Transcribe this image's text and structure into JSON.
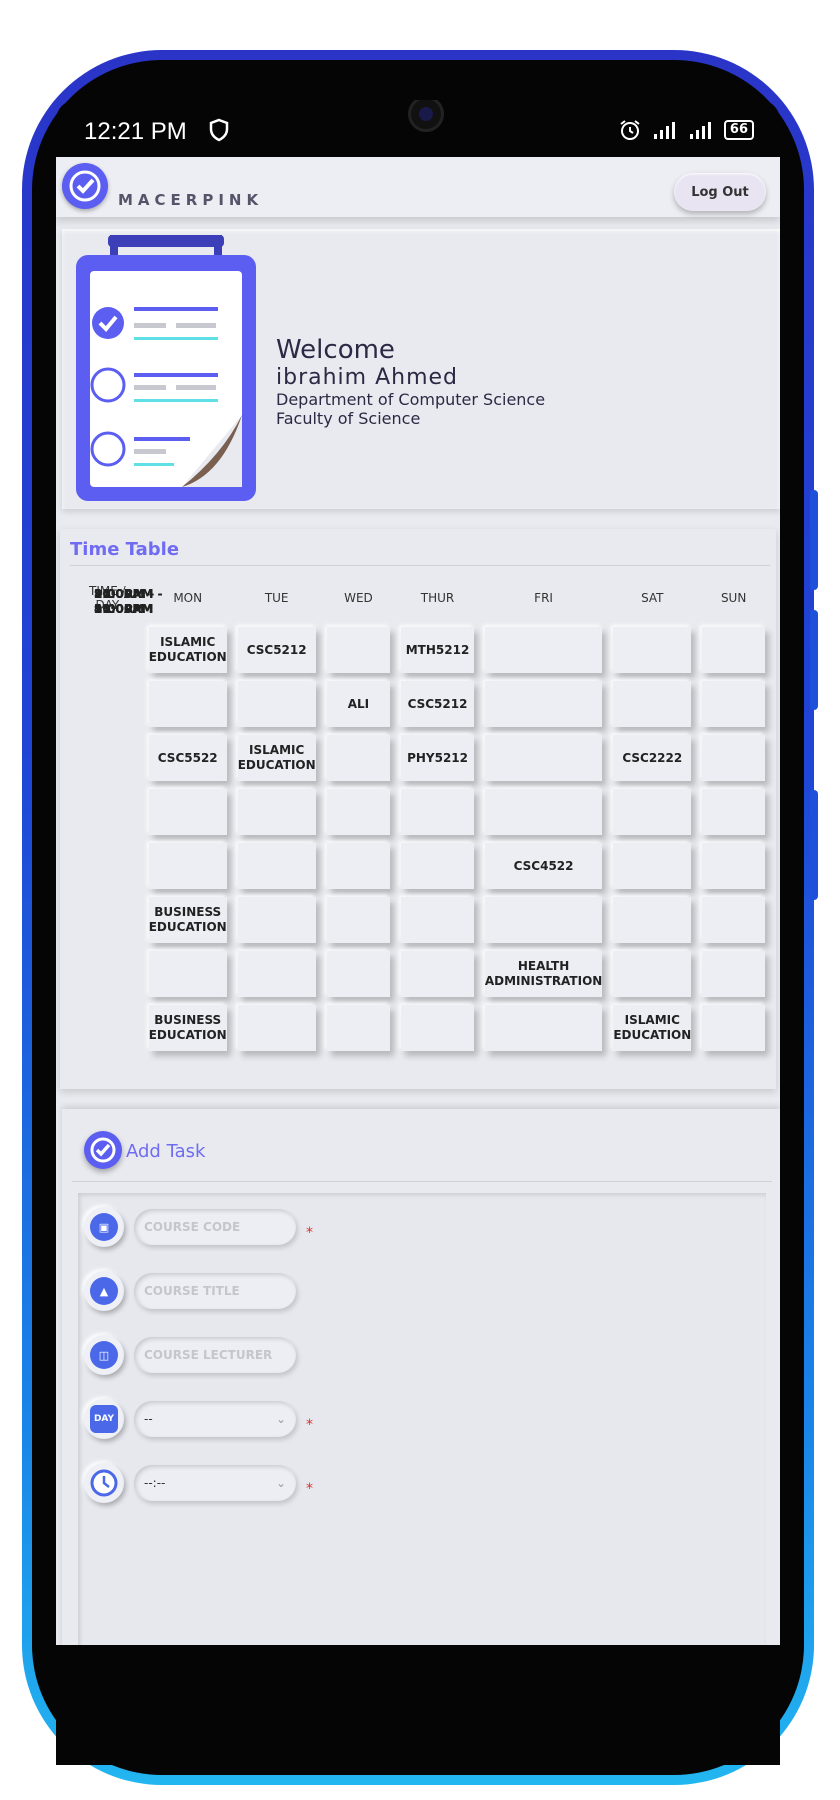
{
  "statusbar": {
    "time": "12:21 PM",
    "battery": "66"
  },
  "header": {
    "brand": "MACERPINK",
    "logout_label": "Log Out"
  },
  "welcome": {
    "greeting": "Welcome",
    "name": "ibrahim Ahmed",
    "department": "Department of Computer Science",
    "faculty": "Faculty of Science"
  },
  "timetable": {
    "title": "Time Table",
    "time_header": "TIME / DAY",
    "days": [
      "MON",
      "TUE",
      "WED",
      "THUR",
      "FRI",
      "SAT",
      "SUN"
    ],
    "rows": [
      {
        "time": "8:00AM - 9:00AM",
        "cells": [
          "ISLAMIC EDUCATION",
          "CSC5212",
          "",
          "MTH5212",
          "",
          "",
          ""
        ]
      },
      {
        "time": "9:00AM - 10:00AM",
        "cells": [
          "",
          "",
          "ALI",
          "CSC5212",
          "",
          "",
          ""
        ]
      },
      {
        "time": "10:00AM - 11:00AM",
        "cells": [
          "CSC5522",
          "ISLAMIC EDUCATION",
          "",
          "PHY5212",
          "",
          "CSC2222",
          ""
        ]
      },
      {
        "time": "11:00AM - 12:00PM",
        "cells": [
          "",
          "",
          "",
          "",
          "",
          "",
          ""
        ]
      },
      {
        "time": "12:00AM - 1:00PM",
        "cells": [
          "",
          "",
          "",
          "",
          "CSC4522",
          "",
          ""
        ]
      },
      {
        "time": "1:00PM - 2:00PM",
        "cells": [
          "BUSINESS EDUCATION",
          "",
          "",
          "",
          "",
          "",
          ""
        ]
      },
      {
        "time": "2:00PM - 3:00PM",
        "cells": [
          "",
          "",
          "",
          "",
          "HEALTH ADMINISTRATION",
          "",
          ""
        ]
      },
      {
        "time": "3:00PM - 4:00PM",
        "cells": [
          "BUSINESS EDUCATION",
          "",
          "",
          "",
          "",
          "ISLAMIC EDUCATION",
          ""
        ]
      }
    ]
  },
  "add_task": {
    "title": "Add Task",
    "course_code_placeholder": "COURSE CODE",
    "course_title_placeholder": "COURSE TITLE",
    "course_lecturer_placeholder": "COURSE LECTURER",
    "day_value": "--",
    "time_value": "--:--",
    "day_icon_label": "DAY",
    "required_mark": "*"
  },
  "colors": {
    "accent": "#5b5ef0",
    "title": "#6f6cf2",
    "required": "#e03030"
  }
}
